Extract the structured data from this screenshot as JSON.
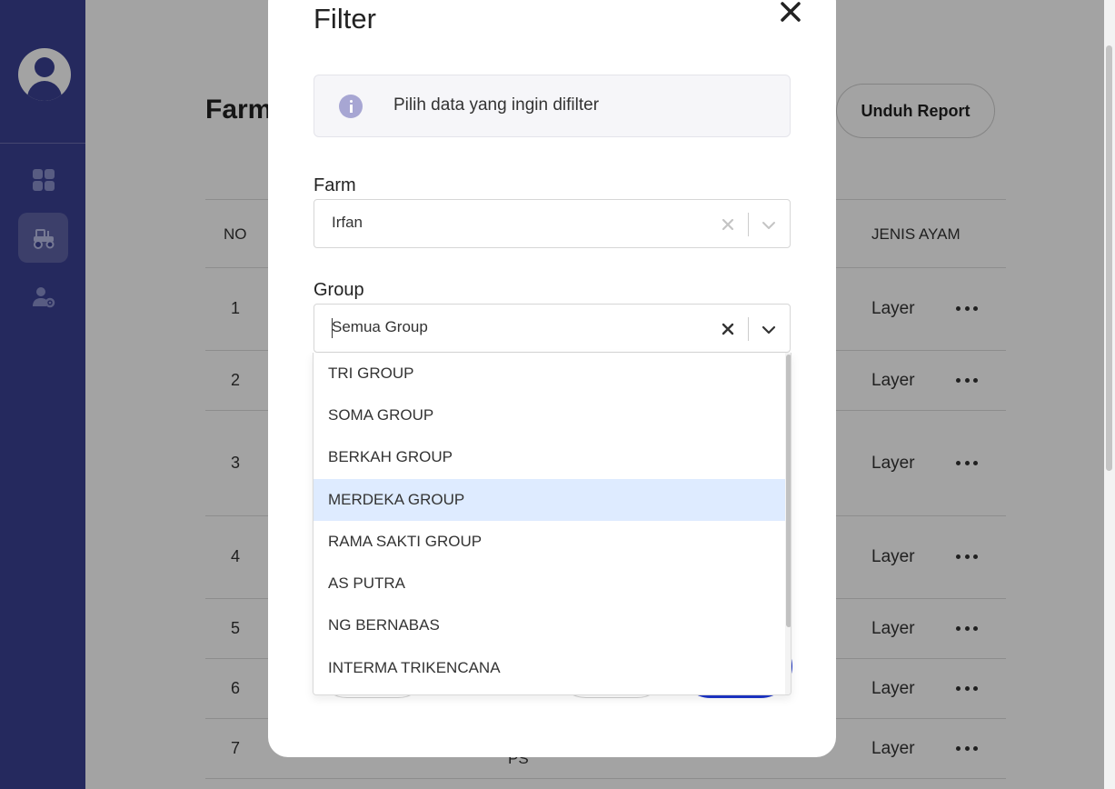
{
  "page": {
    "title": "Farm",
    "download_report_label": "Unduh Report",
    "table": {
      "headers": {
        "no": "NO",
        "jenis": "JENIS AYAM"
      },
      "rows": [
        {
          "no": "1",
          "jenis": "Layer"
        },
        {
          "no": "2",
          "jenis": "Layer"
        },
        {
          "no": "3",
          "jenis": "Layer"
        },
        {
          "no": "4",
          "jenis": "Layer"
        },
        {
          "no": "5",
          "jenis": "Layer"
        },
        {
          "no": "6",
          "jenis": "Layer"
        },
        {
          "no": "7",
          "jenis": "Layer",
          "extra": "PS"
        }
      ]
    }
  },
  "sidebar": {
    "items": [
      {
        "icon": "dashboard-icon"
      },
      {
        "icon": "tractor-icon",
        "active": true
      },
      {
        "icon": "user-settings-icon"
      }
    ]
  },
  "modal": {
    "title": "Filter",
    "info_text": "Pilih data yang ingin difilter",
    "farm": {
      "label": "Farm",
      "value": "Irfan"
    },
    "group": {
      "label": "Group",
      "value": "Semua Group",
      "options": [
        "TRI GROUP",
        "SOMA GROUP",
        "BERKAH GROUP",
        "MERDEKA GROUP",
        "RAMA SAKTI GROUP",
        "AS PUTRA",
        "NG BERNABAS",
        "INTERMA TRIKENCANA"
      ],
      "highlighted": "MERDEKA GROUP"
    }
  },
  "colors": {
    "sidebar": "#3b4194",
    "primary_button": "#1d35c9",
    "highlight": "#deebff"
  }
}
